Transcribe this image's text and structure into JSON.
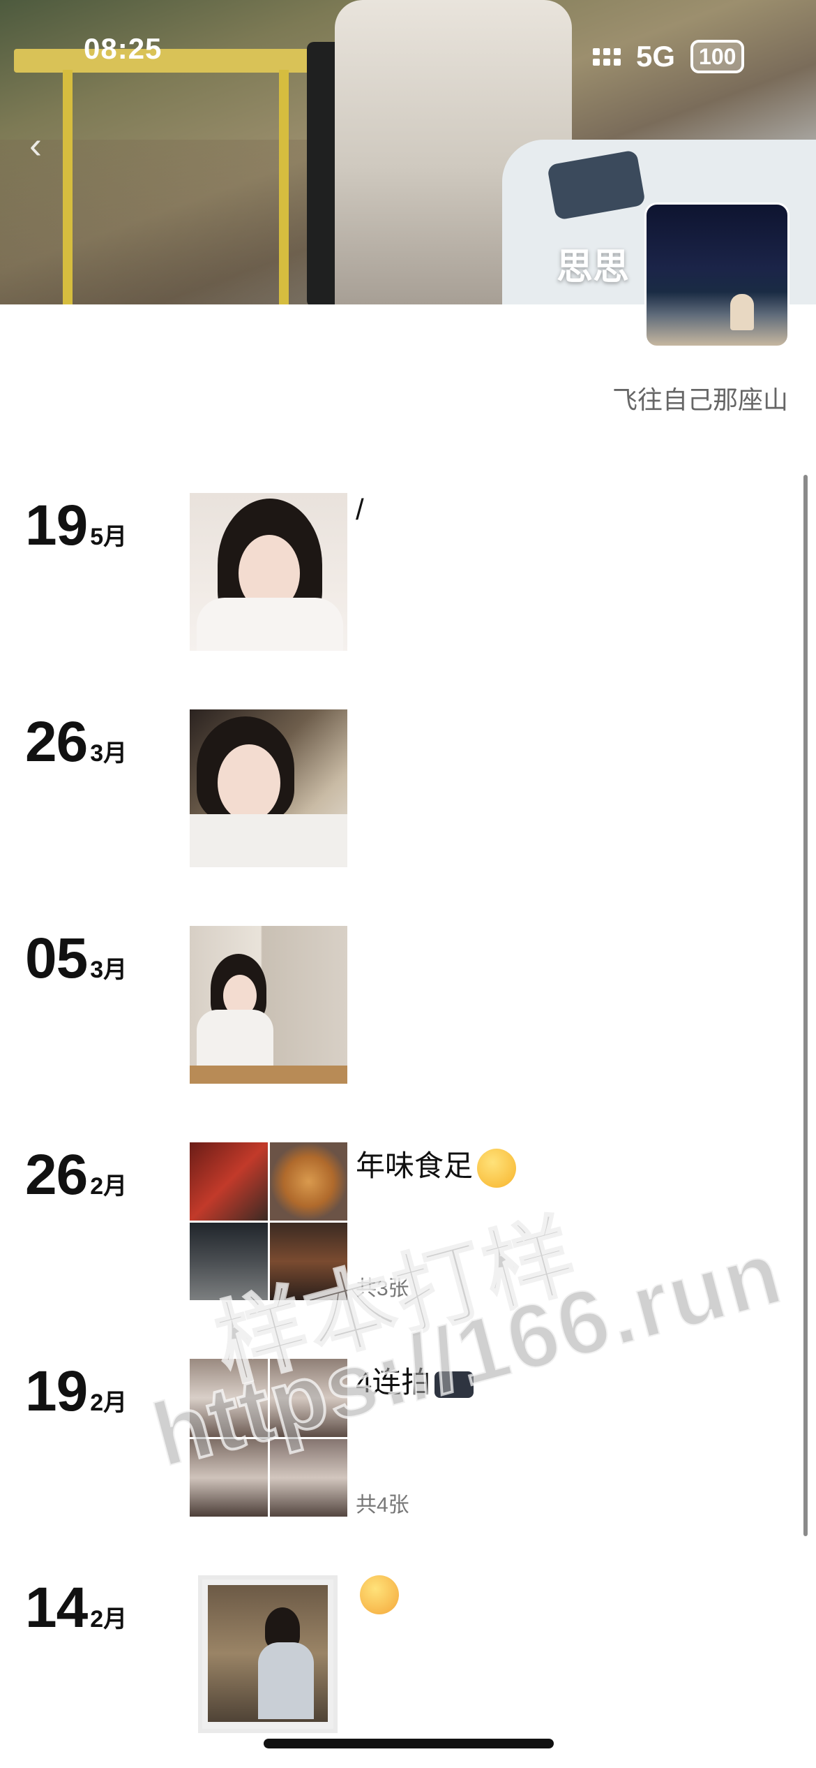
{
  "status_bar": {
    "time": "08:25",
    "network": "5G",
    "battery": "100"
  },
  "profile": {
    "name": "思思",
    "signature": "飞往自己那座山"
  },
  "posts": [
    {
      "day": "19",
      "month": "5月",
      "caption": "/",
      "count": ""
    },
    {
      "day": "26",
      "month": "3月",
      "caption": "",
      "count": ""
    },
    {
      "day": "05",
      "month": "3月",
      "caption": "",
      "count": ""
    },
    {
      "day": "26",
      "month": "2月",
      "caption": "年味食足",
      "count": "共3张",
      "emoji": "yum-face-icon"
    },
    {
      "day": "19",
      "month": "2月",
      "caption": "4连拍",
      "count": "共4张",
      "emoji": "camera-icon"
    },
    {
      "day": "14",
      "month": "2月",
      "caption": "",
      "count": "",
      "emoji": "party-face-icon"
    }
  ],
  "watermark": {
    "line1": "样本打样",
    "line2": "https://166.run"
  },
  "colors": {
    "text": "#111111",
    "muted": "#777777",
    "background": "#ffffff"
  }
}
